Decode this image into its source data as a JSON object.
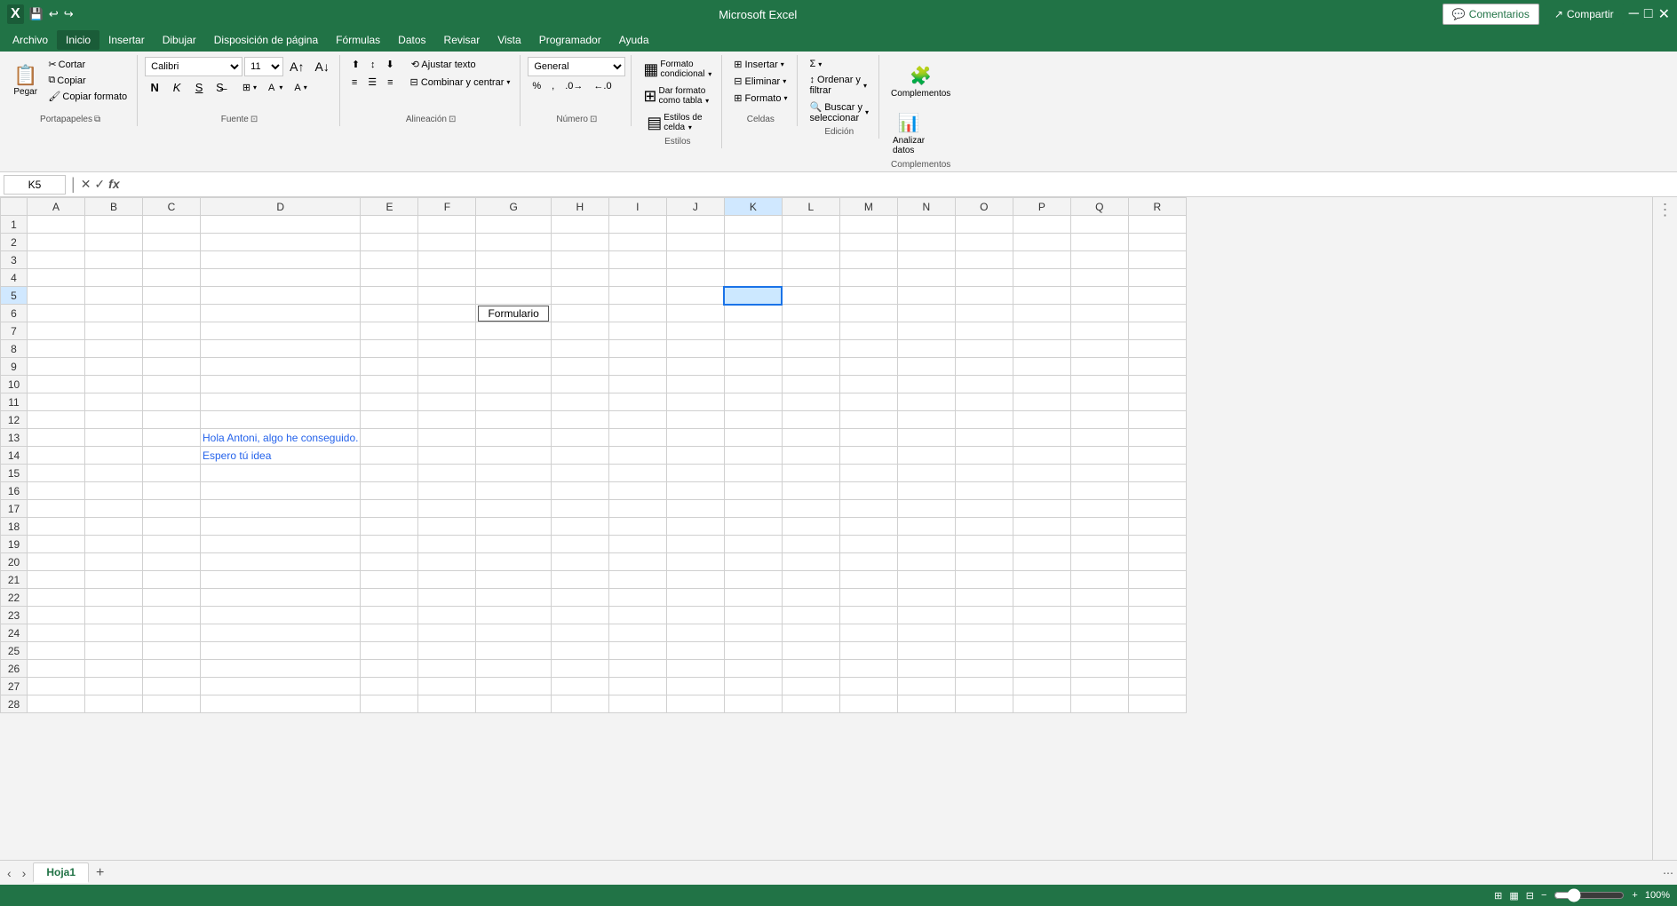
{
  "titleBar": {
    "title": "Microsoft Excel",
    "quickAccess": [
      "save",
      "undo",
      "redo"
    ]
  },
  "menu": {
    "items": [
      "Archivo",
      "Inicio",
      "Insertar",
      "Dibujar",
      "Disposición de página",
      "Fórmulas",
      "Datos",
      "Revisar",
      "Vista",
      "Programador",
      "Ayuda"
    ]
  },
  "ribbon": {
    "tabs": [
      "Inicio"
    ],
    "groups": {
      "portapapeles": {
        "label": "Portapapeles",
        "buttons": [
          "Pegar",
          "Cortar",
          "Copiar",
          "Copiar formato"
        ]
      },
      "fuente": {
        "label": "Fuente",
        "fontName": "Calibri",
        "fontSize": "11",
        "bold": "N",
        "italic": "K",
        "underline": "S"
      },
      "alineacion": {
        "label": "Alineación"
      },
      "numero": {
        "label": "Número",
        "format": "General"
      },
      "estilos": {
        "label": "Estilos",
        "buttons": [
          "Formato condicional",
          "Dar formato como tabla",
          "Estilos de celda"
        ]
      },
      "celdas": {
        "label": "Celdas",
        "buttons": [
          "Insertar",
          "Eliminar",
          "Formato"
        ]
      },
      "edicion": {
        "label": "Edición",
        "buttons": [
          "Suma",
          "Ordenar y filtrar",
          "Buscar y seleccionar"
        ]
      },
      "complementos": {
        "label": "Complementos",
        "buttons": [
          "Complementos",
          "Analizar datos"
        ]
      }
    }
  },
  "formulaBar": {
    "cellRef": "K5",
    "formula": ""
  },
  "sheet": {
    "columns": [
      "A",
      "B",
      "C",
      "D",
      "E",
      "F",
      "G",
      "H",
      "I",
      "J",
      "K",
      "L",
      "M",
      "N",
      "O",
      "P",
      "Q",
      "R"
    ],
    "rows": 28,
    "selectedCell": {
      "row": 5,
      "col": "K"
    },
    "cells": {
      "G6": {
        "value": "Formulario",
        "type": "button"
      },
      "D13": {
        "value": "Hola Antoni, algo he conseguido.",
        "type": "text-blue"
      },
      "D14": {
        "value": "Espero tú idea",
        "type": "text-blue"
      }
    }
  },
  "sheetTabs": {
    "tabs": [
      "Hoja1"
    ],
    "active": "Hoja1"
  },
  "statusBar": {
    "left": "",
    "zoom": 100
  },
  "topRight": {
    "comments": "Comentarios",
    "share": "Compartir"
  }
}
